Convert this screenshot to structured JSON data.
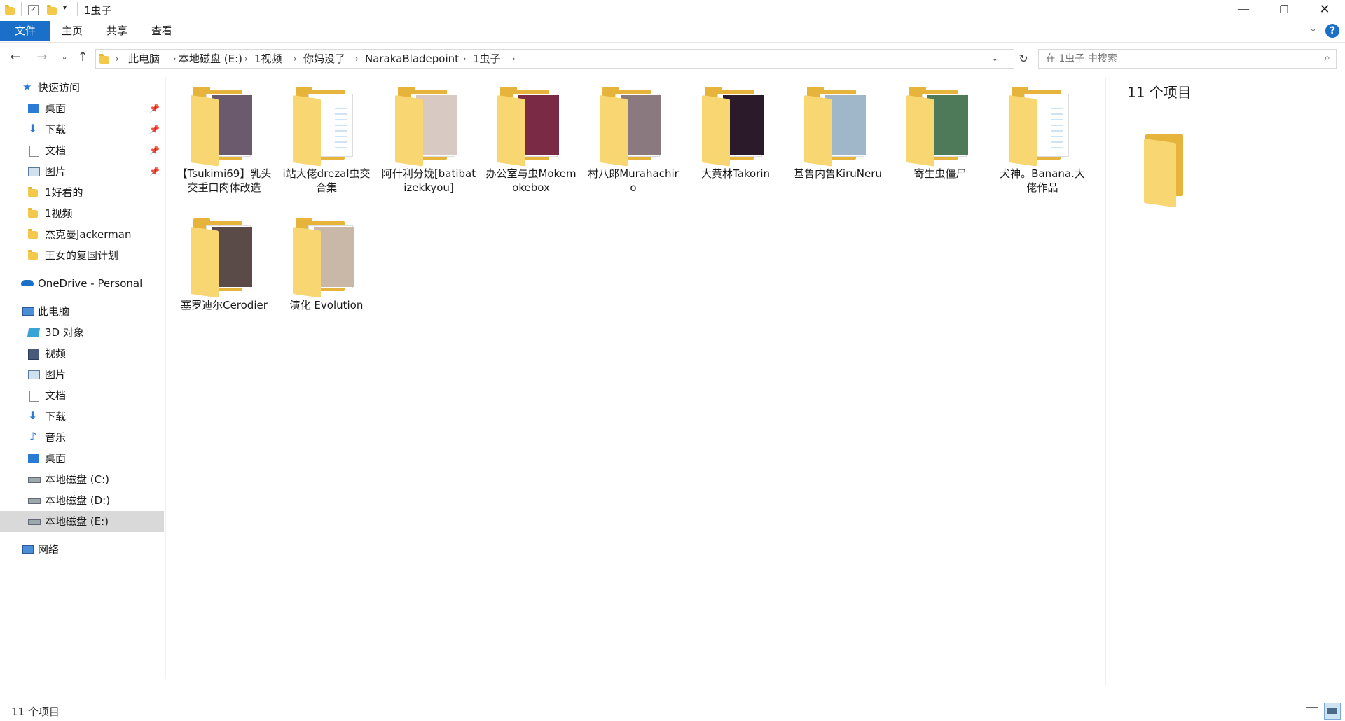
{
  "window": {
    "title": "1虫子",
    "controls": {
      "minimize": "—",
      "maximize": "❐",
      "close": "✕"
    }
  },
  "ribbon": {
    "tabs": [
      "文件",
      "主页",
      "共享",
      "查看"
    ],
    "help": "?"
  },
  "address": {
    "crumbs": [
      "此电脑",
      "本地磁盘 (E:)",
      "1视频",
      "你妈没了",
      "NarakaBladepoint",
      "1虫子"
    ]
  },
  "search": {
    "placeholder": "在 1虫子 中搜索"
  },
  "sidebar": {
    "quick_access": {
      "label": "快速访问",
      "items": [
        {
          "label": "桌面",
          "icon": "desktop-icon",
          "pinned": true
        },
        {
          "label": "下载",
          "icon": "download-icon",
          "pinned": true
        },
        {
          "label": "文档",
          "icon": "document-icon",
          "pinned": true
        },
        {
          "label": "图片",
          "icon": "pictures-icon",
          "pinned": true
        },
        {
          "label": "1好看的",
          "icon": "folder-icon",
          "pinned": false
        },
        {
          "label": "1视频",
          "icon": "folder-icon",
          "pinned": false
        },
        {
          "label": "杰克曼Jackerman",
          "icon": "folder-icon",
          "pinned": false
        },
        {
          "label": "王女的复国计划",
          "icon": "folder-icon",
          "pinned": false
        }
      ]
    },
    "onedrive": {
      "label": "OneDrive - Personal"
    },
    "this_pc": {
      "label": "此电脑",
      "items": [
        {
          "label": "3D 对象",
          "icon": "3d-objects-icon"
        },
        {
          "label": "视频",
          "icon": "videos-icon"
        },
        {
          "label": "图片",
          "icon": "pictures-icon"
        },
        {
          "label": "文档",
          "icon": "document-icon"
        },
        {
          "label": "下载",
          "icon": "download-icon"
        },
        {
          "label": "音乐",
          "icon": "music-icon"
        },
        {
          "label": "桌面",
          "icon": "desktop-icon"
        },
        {
          "label": "本地磁盘 (C:)",
          "icon": "drive-c-icon"
        },
        {
          "label": "本地磁盘 (D:)",
          "icon": "drive-icon"
        },
        {
          "label": "本地磁盘 (E:)",
          "icon": "drive-icon",
          "selected": true
        }
      ]
    },
    "network": {
      "label": "网络"
    }
  },
  "folders": [
    {
      "name": "【Tsukimi69】乳头交重口肉体改造",
      "thumb": "#6b5a6e"
    },
    {
      "name": "i站大佬drezal虫交合集",
      "thumb": null
    },
    {
      "name": "阿什利分娩[batibatizekkyou]",
      "thumb": "#d8c9c2"
    },
    {
      "name": "办公室与虫Mokemokebox",
      "thumb": "#7a2a44"
    },
    {
      "name": "村八郎Murahachiro",
      "thumb": "#8a7a80"
    },
    {
      "name": "大黄林Takorin",
      "thumb": "#2a1a2a"
    },
    {
      "name": "基鲁内鲁KiruNeru",
      "thumb": "#9fb7c9"
    },
    {
      "name": "寄生虫僵尸",
      "thumb": "#4f7a5a"
    },
    {
      "name": "犬神。Banana.大佬作品",
      "thumb": null
    },
    {
      "name": "塞罗迪尔Cerodier",
      "thumb": "#5a4a48"
    },
    {
      "name": "演化 Evolution",
      "thumb": "#c9b8a8"
    }
  ],
  "preview": {
    "count_label": "11 个项目"
  },
  "status": {
    "count_label": "11 个项目"
  },
  "colors": {
    "accent": "#1a6fc9",
    "folder": "#f3c84b",
    "selected": "#d9d9d9"
  }
}
